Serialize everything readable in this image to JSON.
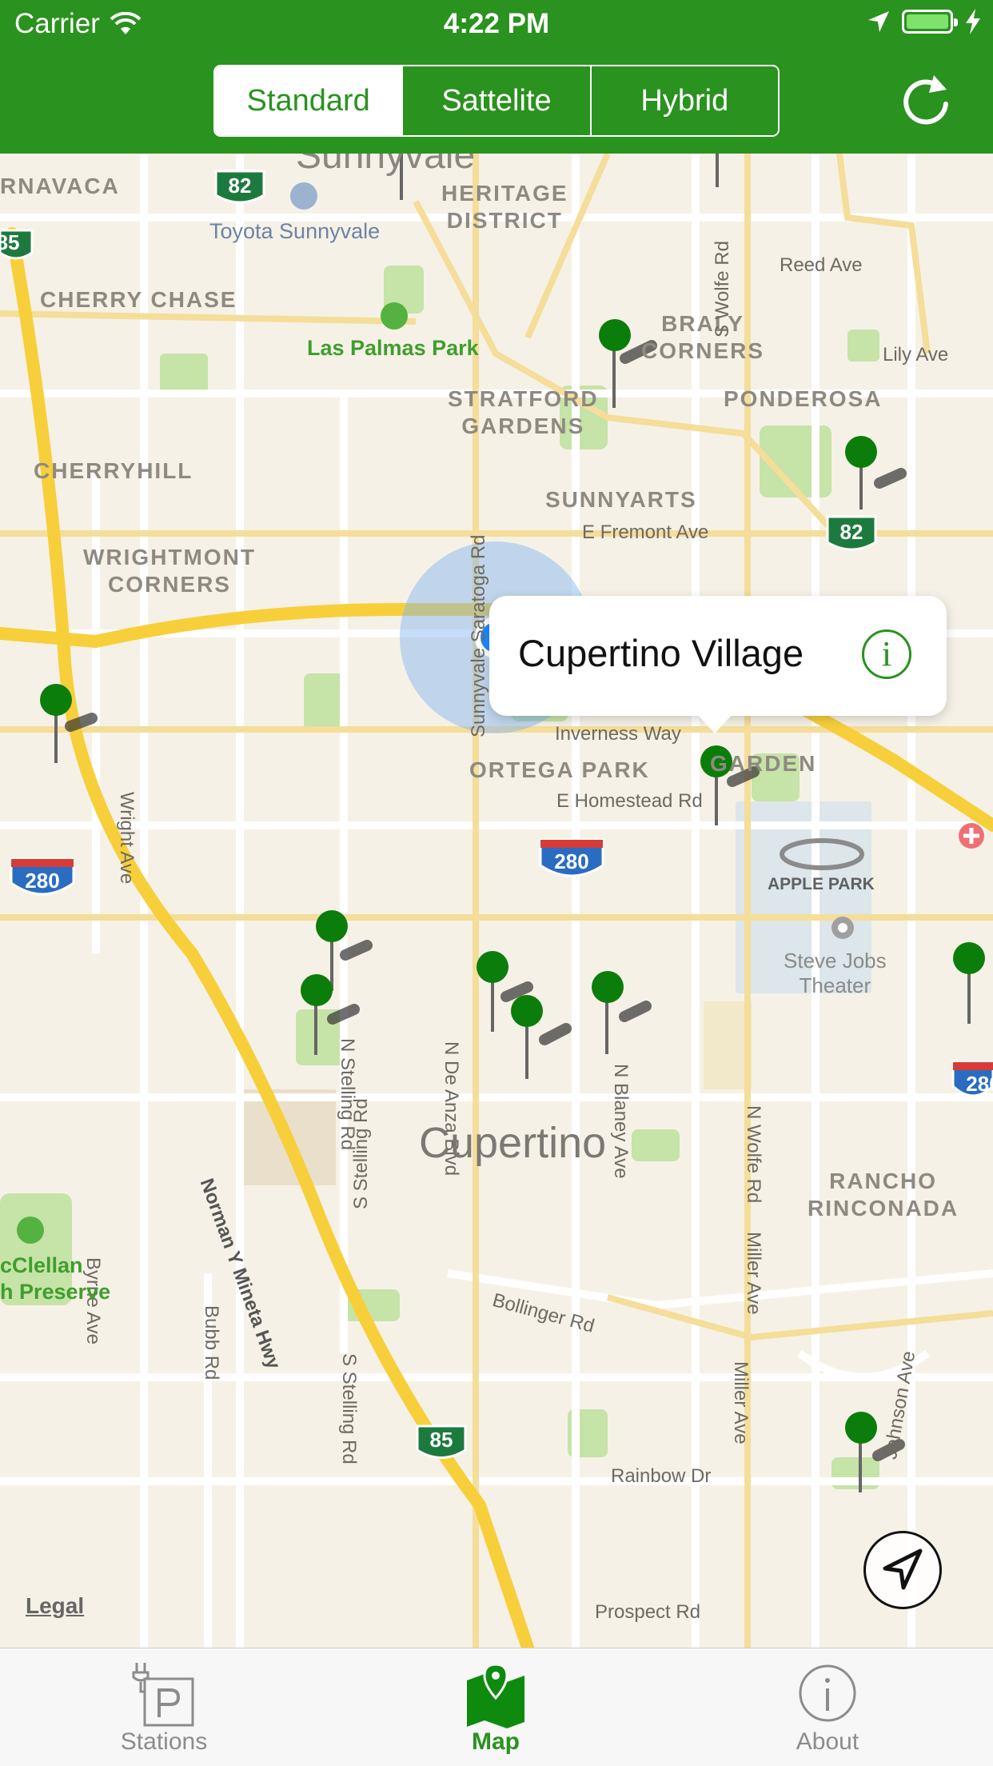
{
  "status_bar": {
    "carrier": "Carrier",
    "time": "4:22 PM"
  },
  "map_type": {
    "options": [
      "Standard",
      "Sattelite",
      "Hybrid"
    ],
    "selected": "Standard"
  },
  "callout": {
    "title": "Cupertino Village"
  },
  "map_labels": {
    "sunnyvale": "Sunnyvale",
    "heritage_district": "HERITAGE\nDISTRICT",
    "cuernavaca": "RNAVACA",
    "toyota": "Toyota Sunnyvale",
    "cherry_chase": "CHERRY CHASE",
    "las_palmas": "Las Palmas Park",
    "braly": "BRALY\nCORNERS",
    "lily": "Lily Ave",
    "reed": "Reed Ave",
    "wolfe_top": "S Wolfe Rd",
    "stratford": "STRATFORD\nGARDENS",
    "ponderosa": "PONDEROSA",
    "cherryhill": "CHERRYHILL",
    "sunnyarts": "SUNNYARTS",
    "fremont": "E Fremont Ave",
    "wrightmont": "WRIGHTMONT\nCORNERS",
    "saratoga": "Sunnyvale Saratoga Rd",
    "wright": "Wright Ave",
    "inverness": "Inverness Way",
    "ortega": "ORTEGA PARK",
    "garden": "GARDEN",
    "homestead": "E Homestead Rd",
    "apple_park": "APPLE PARK",
    "steve_jobs": "Steve Jobs\nTheater",
    "stelling_n": "N Stelling Rd",
    "de_anza": "N De Anza Blvd",
    "blaney": "N Blaney Ave",
    "wolfe_n": "N Wolfe Rd",
    "miller": "Miller Ave",
    "norman": "Norman Y Mineta Hwy",
    "stelling_s": "S Stelling Rd",
    "byrne": "Byrne Ave",
    "cupertino": "Cupertino",
    "rancho": "RANCHO\nRINCONADA",
    "mcclellan": "cClellan\nh Preserve",
    "bollinger": "Bollinger Rd",
    "bubb": "Bubb Rd",
    "stelling_s2": "S Stelling Rd",
    "miller2": "Miller Ave",
    "johnson": "Johnson Ave",
    "rainbow": "Rainbow Dr",
    "prospect": "Prospect Rd",
    "hwy_82": "82",
    "hwy_85": "85",
    "hwy_280": "280"
  },
  "legal": "Legal",
  "tabs": [
    {
      "label": "Stations",
      "icon": "charging-station-icon",
      "active": false
    },
    {
      "label": "Map",
      "icon": "map-icon",
      "active": true
    },
    {
      "label": "About",
      "icon": "info-icon",
      "active": false
    }
  ],
  "colors": {
    "brand_green": "#2a921f",
    "pin_green": "#0b7d0b",
    "location_blue": "#1e88ff"
  }
}
